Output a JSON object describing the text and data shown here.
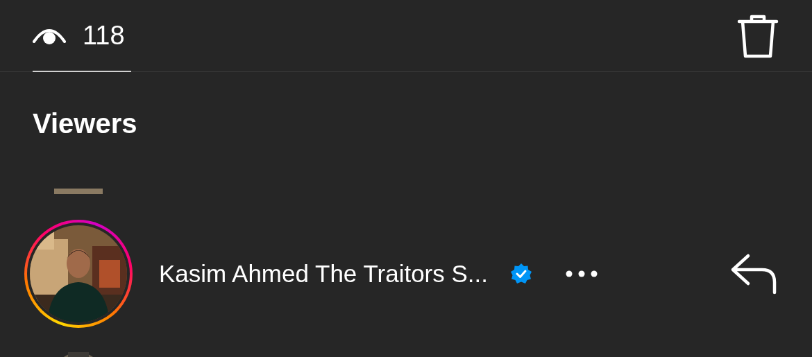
{
  "tabs": [
    {
      "label": "118",
      "selected": true
    }
  ],
  "section_title": "Viewers",
  "viewers": [
    {
      "name": "Kasim Ahmed The Traitors S...",
      "verified": true,
      "story_ring": true
    }
  ]
}
